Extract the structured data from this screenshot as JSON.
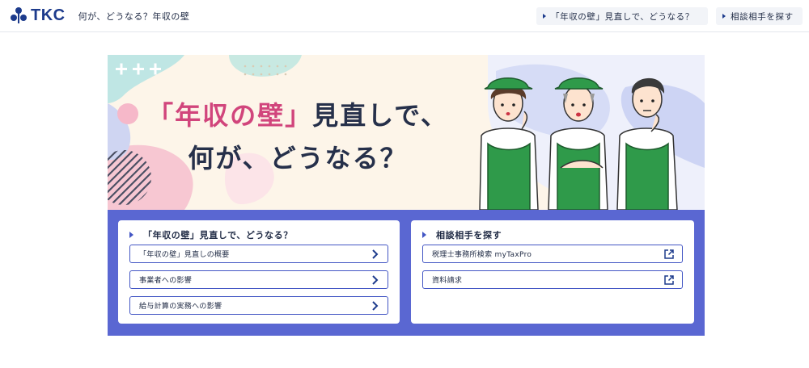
{
  "header": {
    "logo_text": "TKC",
    "site_title": "何が、どうなる？年収の壁",
    "nav": [
      {
        "label": "「年収の壁」見直しで、どうなる？"
      },
      {
        "label": "相談相手を探す"
      }
    ]
  },
  "hero": {
    "line1_highlight": "「年収の壁」",
    "line1_rest": "見直しで、",
    "line2": "何が、どうなる？"
  },
  "left_card": {
    "heading": "「年収の壁」見直しで、どうなる？",
    "links": [
      {
        "label": "「年収の壁」見直しの概要"
      },
      {
        "label": "事業者への影響"
      },
      {
        "label": "給与計算の実務への影響"
      }
    ]
  },
  "right_card": {
    "heading": "相談相手を探す",
    "links": [
      {
        "label": "税理士事務所検索 myTaxPro"
      },
      {
        "label": "資料請求"
      }
    ]
  },
  "colors": {
    "brand": "#1d3b8c",
    "panel": "#5a67d2",
    "accent_pink": "#d1457c",
    "apron_green": "#2f9a4a"
  }
}
